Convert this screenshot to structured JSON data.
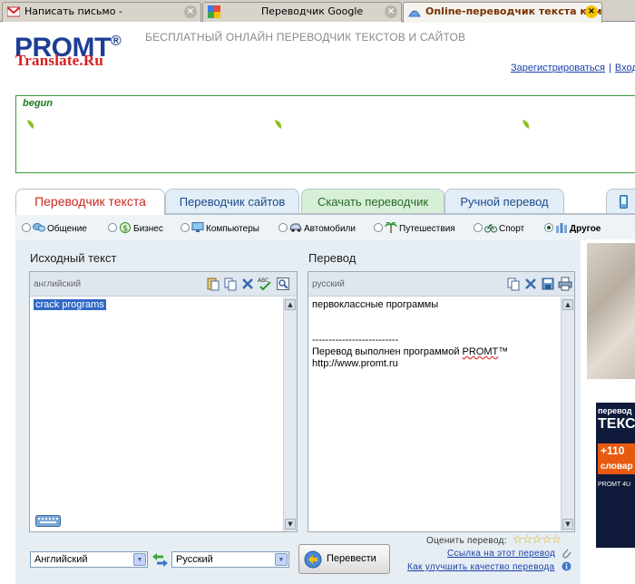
{
  "browser": {
    "tabs": [
      {
        "title": "Написать письмо -",
        "icon": "gmail-icon",
        "active": false
      },
      {
        "title": "Переводчик Google",
        "icon": "google-icon",
        "active": false
      },
      {
        "title": "Online-переводчик текста комп...",
        "icon": "promt-icon",
        "active": true
      }
    ],
    "close_glyph": "×"
  },
  "header": {
    "logo_main": "PROMT",
    "logo_reg": "®",
    "logo_sub": "Translate.Ru",
    "tagline": "БЕСПЛАТНЫЙ ОНЛАЙН ПЕРЕВОДЧИК ТЕКСТОВ И САЙТОВ",
    "register_link": "Зарегистрироваться",
    "separator": "|",
    "login_link": "Вход"
  },
  "ad": {
    "label": "begun"
  },
  "section_tabs": [
    {
      "label": "Переводчик текста",
      "active": true
    },
    {
      "label": "Переводчик сайтов",
      "active": false
    },
    {
      "label": "Скачать переводчик",
      "active": false
    },
    {
      "label": "Ручной перевод",
      "active": false
    }
  ],
  "categories": [
    {
      "label": "Общение",
      "icon": "chat-icon",
      "selected": false
    },
    {
      "label": "Бизнес",
      "icon": "dollar-icon",
      "selected": false
    },
    {
      "label": "Компьютеры",
      "icon": "monitor-icon",
      "selected": false
    },
    {
      "label": "Автомобили",
      "icon": "car-icon",
      "selected": false
    },
    {
      "label": "Путешествия",
      "icon": "palm-icon",
      "selected": false
    },
    {
      "label": "Спорт",
      "icon": "bicycle-icon",
      "selected": false
    },
    {
      "label": "Другое",
      "icon": "bars-icon",
      "selected": true
    }
  ],
  "source": {
    "title": "Исходный текст",
    "lang": "английский",
    "text": "crack programs"
  },
  "target": {
    "title": "Перевод",
    "lang": "русский",
    "line1": "первоклассные программы",
    "divider": "--------------------------",
    "credit_prefix": "Перевод выполнен программой ",
    "credit_brand": "PROMT",
    "credit_tm": "™",
    "url": "http://www.promt.ru"
  },
  "controls": {
    "from_lang": "Английский",
    "to_lang": "Русский",
    "translate_button": "Перевести",
    "rate_label": "Оценить перевод:",
    "stars": "☆☆☆☆☆",
    "link_label": "Ссылка на этот перевод",
    "improve_label": "Как улучшить качество перевода"
  },
  "banner": {
    "line1": "перевод",
    "line2": "ТЕКС",
    "line3": "+110",
    "line3b": "словар",
    "line4": "PROMT 4U"
  },
  "colors": {
    "brand_blue": "#1c3f94",
    "brand_red": "#d81e1e",
    "link": "#1a3fa8",
    "ad_border": "#3a9a3a"
  }
}
